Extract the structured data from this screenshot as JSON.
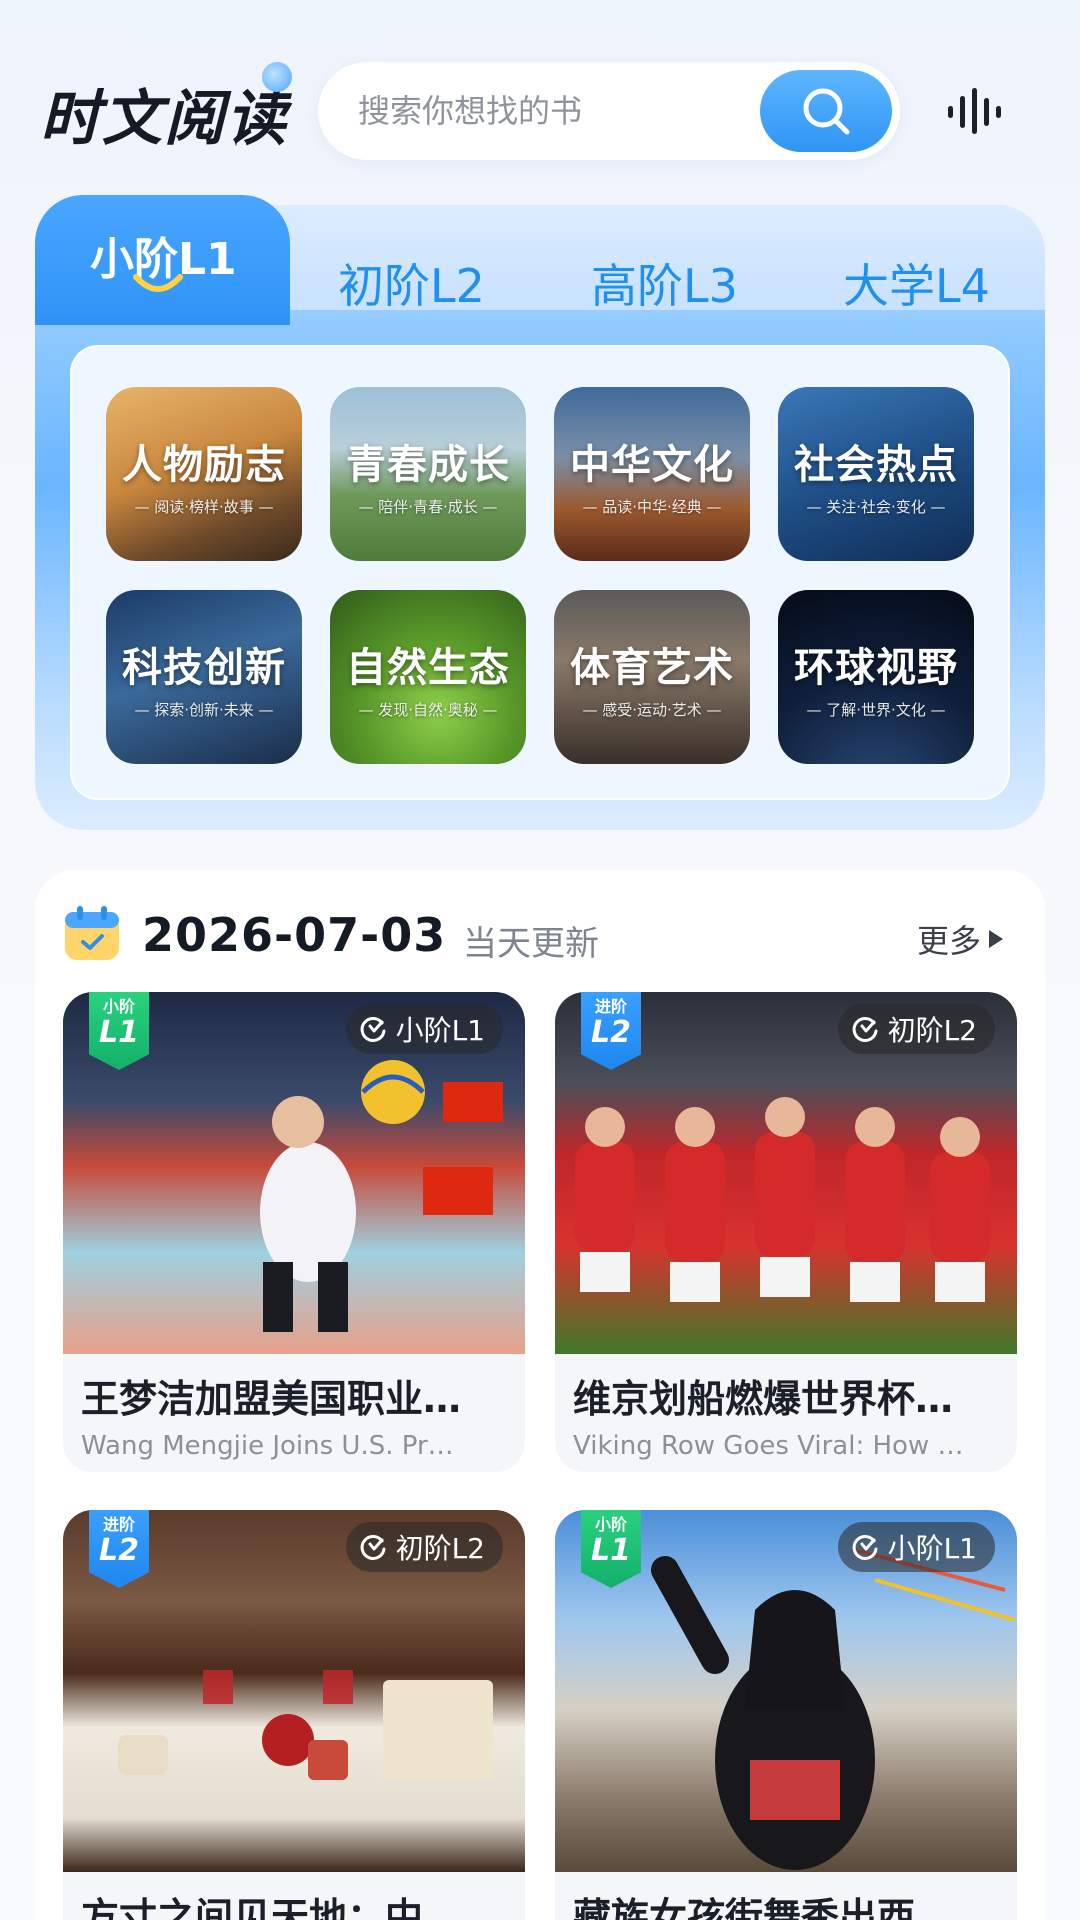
{
  "header": {
    "app_title": "时文阅读",
    "search_placeholder": "搜索你想找的书"
  },
  "levels": {
    "active": "小阶L1",
    "tabs": [
      "初阶L2",
      "高阶L3",
      "大学L4"
    ]
  },
  "categories": [
    {
      "name": "人物励志",
      "sub": "— 阅读·榜样·故事 —"
    },
    {
      "name": "青春成长",
      "sub": "— 陪伴·青春·成长 —"
    },
    {
      "name": "中华文化",
      "sub": "— 品读·中华·经典 —"
    },
    {
      "name": "社会热点",
      "sub": "— 关注·社会·变化 —"
    },
    {
      "name": "科技创新",
      "sub": "— 探索·创新·未来 —"
    },
    {
      "name": "自然生态",
      "sub": "— 发现·自然·奥秘 —"
    },
    {
      "name": "体育艺术",
      "sub": "— 感受·运动·艺术 —"
    },
    {
      "name": "环球视野",
      "sub": "— 了解·世界·文化 —"
    }
  ],
  "updates": {
    "date": "2026-07-03",
    "label": "当天更新",
    "more": "更多"
  },
  "articles": [
    {
      "tag_top": "小阶",
      "tag_level": "L1",
      "pill": "小阶L1",
      "title": "王梦洁加盟美国职业…",
      "subtitle": "Wang Mengjie Joins U.S. Pr…"
    },
    {
      "tag_top": "进阶",
      "tag_level": "L2",
      "pill": "初阶L2",
      "title": "维京划船燃爆世界杯…",
      "subtitle": "Viking Row Goes Viral: How …"
    },
    {
      "tag_top": "进阶",
      "tag_level": "L2",
      "pill": "初阶L2",
      "title": "方寸之间见天地：中…",
      "subtitle": ""
    },
    {
      "tag_top": "小阶",
      "tag_level": "L1",
      "pill": "小阶L1",
      "title": "藏族女孩街舞秀出西…",
      "subtitle": ""
    }
  ],
  "colors": {
    "accent": "#2f95f4",
    "tag_green": "#16c27a",
    "tag_blue": "#2b8cf2"
  }
}
